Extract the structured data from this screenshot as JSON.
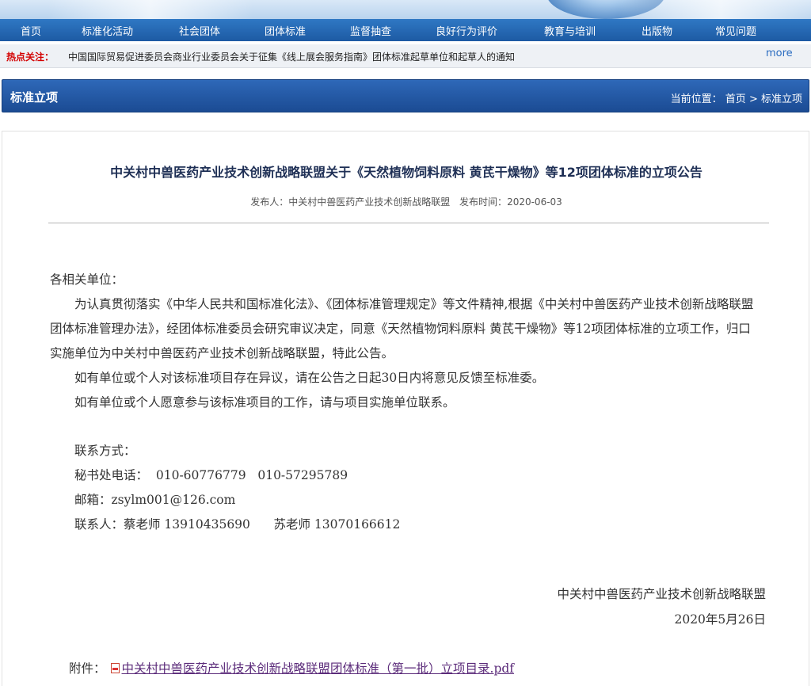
{
  "nav": {
    "items": [
      "首页",
      "标准化活动",
      "社会团体",
      "团体标准",
      "监督抽查",
      "良好行为评价",
      "教育与培训",
      "出版物",
      "常见问题"
    ]
  },
  "hot": {
    "label": "热点关注：",
    "text": "中国国际贸易促进委员会商业行业委员会关于征集《线上展会服务指南》团体标准起草单位和起草人的通知",
    "more": "more"
  },
  "section": {
    "title": "标准立项",
    "crumb_prefix": "当前位置：",
    "crumb_home": "首页",
    "crumb_sep": ">",
    "crumb_current": "标准立项"
  },
  "article": {
    "title": "中关村中兽医药产业技术创新战略联盟关于《天然植物饲料原料 黄芪干燥物》等12项团体标准的立项公告",
    "publisher_label": "发布人：",
    "publisher": "中关村中兽医药产业技术创新战略联盟",
    "date_label": "发布时间：",
    "date": "2020-06-03",
    "salutation": "各相关单位：",
    "para1": "为认真贯彻落实《中华人民共和国标准化法》、《团体标准管理规定》等文件精神,根据《中关村中兽医药产业技术创新战略联盟团体标准管理办法》，经团体标准委员会研究审议决定，同意《天然植物饲料原料 黄芪干燥物》等12项团体标准的立项工作，归口实施单位为中关村中兽医药产业技术创新战略联盟，特此公告。",
    "para2": "如有单位或个人对该标准项目存在异议，请在公告之日起30日内将意见反馈至标准委。",
    "para3": "如有单位或个人愿意参与该标准项目的工作，请与项目实施单位联系。",
    "contact_heading": "联系方式：",
    "phone_line": "秘书处电话：  010-60776779   010-57295789",
    "email_line": "邮箱：zsylm001@126.com",
    "people_line": "联系人：蔡老师 13910435690      苏老师 13070166612",
    "sign_org": "中关村中兽医药产业技术创新战略联盟",
    "sign_date": "2020年5月26日",
    "attach_label": "附件：",
    "attach_link": "中关村中兽医药产业技术创新战略联盟团体标准（第一批）立项目录.pdf"
  },
  "colors": {
    "nav": "#1d5aa3",
    "hot_label": "#d40000",
    "section_bar": "#1b4b93",
    "link": "#5b2b7a"
  }
}
